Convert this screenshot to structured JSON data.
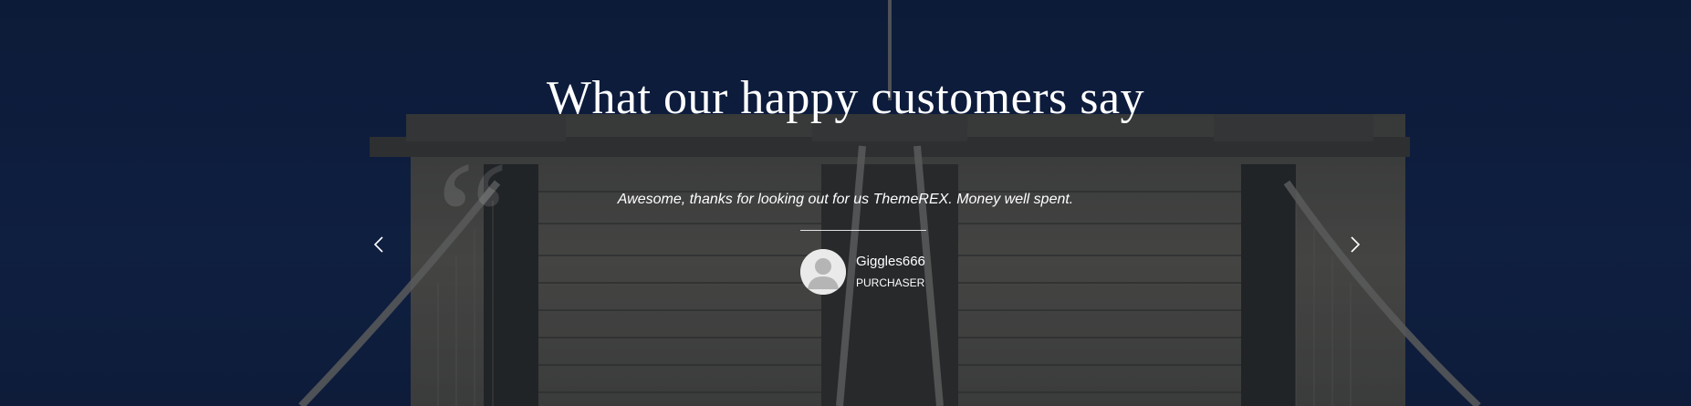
{
  "testimonials": {
    "title": "What our happy customers say",
    "quote_mark": "“",
    "quote": "Awesome, thanks for looking out for us ThemeREX. Money well spent.",
    "author": {
      "name": "Giggles666",
      "role": "PURCHASER"
    },
    "nav": {
      "prev_icon": "chevron-left-icon",
      "next_icon": "chevron-right-icon"
    }
  },
  "colors": {
    "sky": "#10203f",
    "stone": "#5a574d",
    "text": "#ffffff"
  }
}
